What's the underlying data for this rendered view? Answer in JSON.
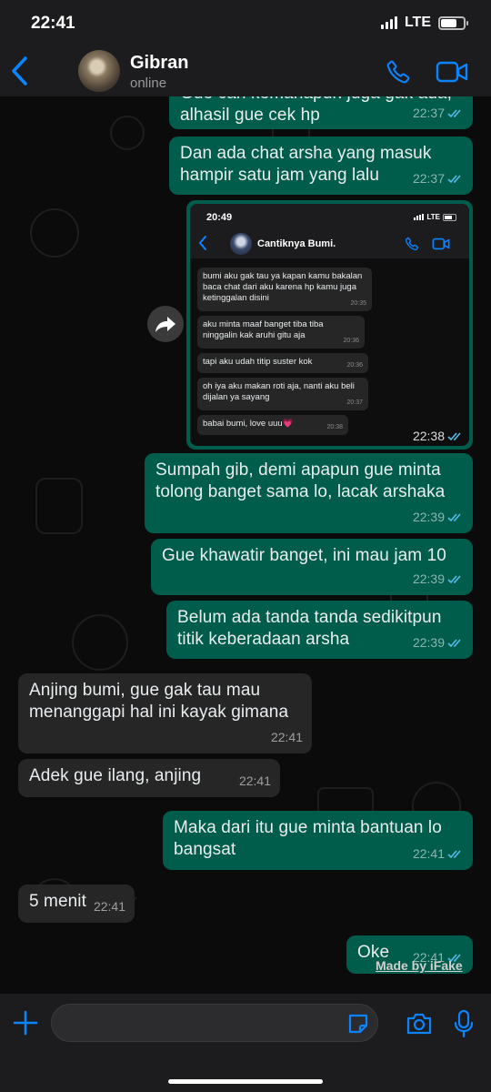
{
  "status_bar": {
    "time": "22:41",
    "network": "LTE"
  },
  "contact": {
    "name": "Gibran",
    "status": "online"
  },
  "messages": [
    {
      "dir": "out",
      "text": "Gue cari kemanapun juga gak ada, alhasil gue cek hp",
      "time": "22:37"
    },
    {
      "dir": "out",
      "text": "Dan ada chat arsha yang masuk hampir satu jam yang lalu",
      "time": "22:37"
    },
    {
      "dir": "out",
      "text": "Sumpah gib, demi apapun gue minta tolong banget sama lo, lacak arshaka",
      "time": "22:39"
    },
    {
      "dir": "out",
      "text": "Gue khawatir banget, ini mau jam 10",
      "time": "22:39"
    },
    {
      "dir": "out",
      "text": "Belum ada tanda tanda sedikitpun titik keberadaan arsha",
      "time": "22:39"
    },
    {
      "dir": "in",
      "text": "Anjing bumi, gue gak tau mau menanggapi hal ini kayak gimana",
      "time": "22:41"
    },
    {
      "dir": "in",
      "text": "Adek gue ilang, anjing",
      "time": "22:41"
    },
    {
      "dir": "out",
      "text": "Maka dari itu gue minta bantuan lo bangsat",
      "time": "22:41"
    },
    {
      "dir": "in",
      "text": "5 menit",
      "time": "22:41"
    },
    {
      "dir": "out",
      "text": "Oke",
      "time": "22:41"
    }
  ],
  "image_message": {
    "time": "22:38",
    "screenshot": {
      "time": "20:49",
      "contact_name": "Cantiknya Bumi.",
      "messages": [
        {
          "text": "bumi aku gak tau ya kapan kamu bakalan baca chat dari aku karena hp kamu juga ketinggalan disini",
          "time": "20:35"
        },
        {
          "text": "aku minta maaf banget tiba tiba ninggalin kak aruhi gitu aja",
          "time": "20:36"
        },
        {
          "text": "tapi aku udah titip suster kok",
          "time": "20:36"
        },
        {
          "text": "oh iya aku makan roti aja, nanti aku beli dijalan ya sayang",
          "time": "20:37"
        },
        {
          "text": "babai bumi, love uuu💗",
          "time": "20:38"
        }
      ]
    }
  },
  "watermark": "Made by iFake",
  "icons": {
    "back": "chevron-left-icon",
    "call": "phone-icon",
    "video": "video-camera-icon",
    "forward": "forward-arrow-icon",
    "plus": "plus-icon",
    "sticker": "sticker-icon",
    "camera": "camera-icon",
    "mic": "microphone-icon",
    "read": "double-check-icon"
  },
  "colors": {
    "accent": "#0a84ff",
    "outgoing_bubble": "#005c4b",
    "incoming_bubble": "#262626",
    "read_ticks": "#53bdeb"
  }
}
